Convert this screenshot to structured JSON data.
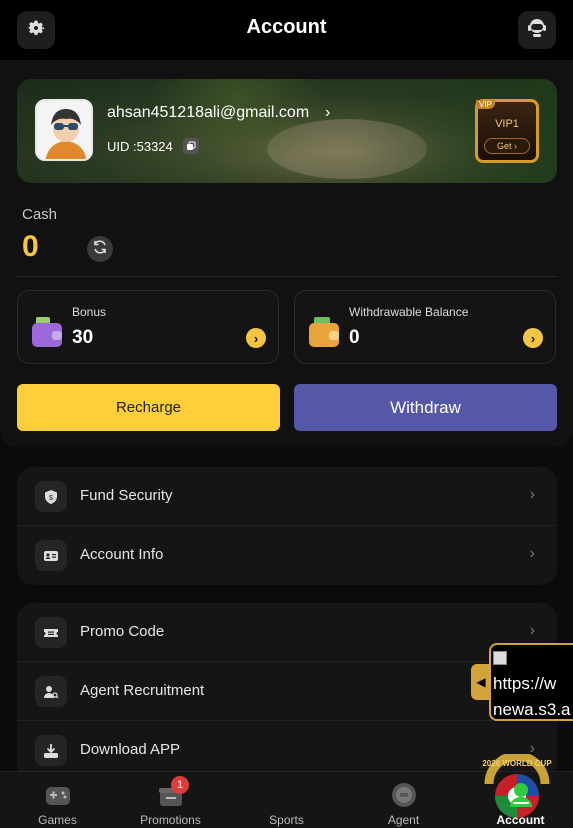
{
  "header": {
    "title": "Account",
    "settings_icon": "gear-icon",
    "support_icon": "headset-icon"
  },
  "profile": {
    "email": "ahsan451218ali@gmail.com",
    "email_arrow": "›",
    "uid": "UID :53324",
    "copy_icon": "copy-icon"
  },
  "vip": {
    "corner": "VIP",
    "level": "VIP1",
    "get_label": "Get ›"
  },
  "cash": {
    "label": "Cash",
    "value": "0",
    "refresh_icon": "refresh-icon"
  },
  "balances": [
    {
      "name": "Bonus",
      "value": "30",
      "icon": "wallet-icon"
    },
    {
      "name": "Withdrawable Balance",
      "value": "0",
      "icon": "wallet-icon"
    }
  ],
  "actions": {
    "recharge": "Recharge",
    "withdraw": "Withdraw"
  },
  "menu_group_1": [
    {
      "label": "Fund Security",
      "icon": "shield-icon"
    },
    {
      "label": "Account Info",
      "icon": "id-card-icon"
    }
  ],
  "menu_group_2": [
    {
      "label": "Promo Code",
      "icon": "ticket-icon"
    },
    {
      "label": "Agent Recruitment",
      "icon": "user-search-icon"
    },
    {
      "label": "Download APP",
      "icon": "download-icon"
    }
  ],
  "menu_arrow": "›",
  "floating_ad": {
    "text_line1": "https://w",
    "text_line2": "newa.s3.a"
  },
  "bottom_nav": [
    {
      "label": "Games",
      "icon": "gamepad-icon"
    },
    {
      "label": "Promotions",
      "icon": "gift-icon",
      "badge": "1"
    },
    {
      "label": "Sports",
      "icon": "world-cup-icon"
    },
    {
      "label": "Agent",
      "icon": "coin-stack-icon"
    },
    {
      "label": "Account",
      "icon": "user-icon",
      "active": true
    }
  ],
  "colors": {
    "accent_yellow": "#fecf3a",
    "withdraw_purple": "#5557a8",
    "active_green": "#2ecc40",
    "badge_red": "#e23b3b"
  }
}
